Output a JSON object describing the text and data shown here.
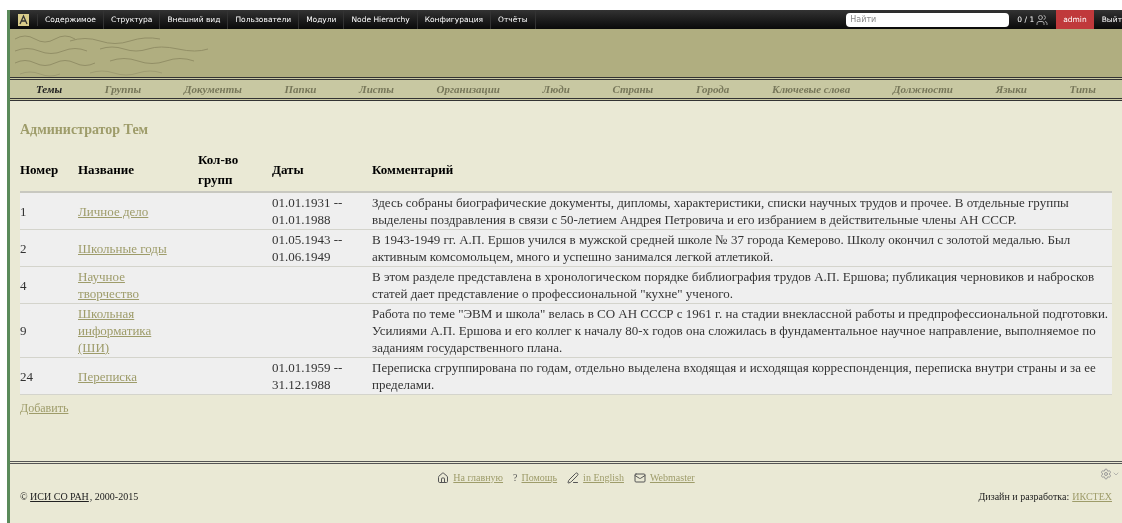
{
  "toolbar": {
    "menu": [
      "Содержимое",
      "Структура",
      "Внешний вид",
      "Пользователи",
      "Модули",
      "Node Hierarchy",
      "Конфигурация",
      "Отчёты"
    ],
    "search": {
      "placeholder": "Найти"
    },
    "users_count": "0 / 1",
    "user": "admin",
    "logout": "Выйт"
  },
  "nav": [
    {
      "label": "Темы",
      "selected": true
    },
    {
      "label": "Группы",
      "selected": false
    },
    {
      "label": "Документы",
      "selected": false
    },
    {
      "label": "Папки",
      "selected": false
    },
    {
      "label": "Листы",
      "selected": false
    },
    {
      "label": "Организации",
      "selected": false
    },
    {
      "label": "Люди",
      "selected": false
    },
    {
      "label": "Страны",
      "selected": false
    },
    {
      "label": "Города",
      "selected": false
    },
    {
      "label": "Ключевые слова",
      "selected": false
    },
    {
      "label": "Должности",
      "selected": false
    },
    {
      "label": "Языки",
      "selected": false
    },
    {
      "label": "Типы",
      "selected": false
    }
  ],
  "page_title": "Администратор Тем",
  "table": {
    "columns": [
      "Номер",
      "Название",
      "Кол-во групп",
      "Даты",
      "Комментарий"
    ],
    "rows": [
      {
        "number": "1",
        "name": "Личное дело",
        "groups": "",
        "dates": "01.01.1931 -- 01.01.1988",
        "comment": "Здесь собраны биографические документы, дипломы, характеристики, списки научных трудов и прочее. В отдельные группы выделены поздравления в связи с 50-летием Андрея Петровича и его избранием в действительные члены АН СССР."
      },
      {
        "number": "2",
        "name": "Школьные годы",
        "groups": "",
        "dates": "01.05.1943 -- 01.06.1949",
        "comment": "В 1943-1949 гг. А.П. Ершов учился в мужской средней школе № 37 города Кемерово. Школу окончил с золотой медалью. Был активным комсомольцем, много и успешно занимался легкой атлетикой."
      },
      {
        "number": "4",
        "name": "Научное творчество",
        "groups": "",
        "dates": "",
        "comment": "В этом разделе представлена в хронологическом порядке библиография трудов А.П. Ершова; публикация черновиков и набросков статей дает представление о профессиональной \"кухне\" ученого."
      },
      {
        "number": "9",
        "name": "Школьная информатика (ШИ)",
        "groups": "",
        "dates": "",
        "comment": "Работа по теме \"ЭВМ и школа\" велась в СО АН СССР с 1961 г. на стадии внеклассной работы и предпрофессиональной подготовки. Усилиями А.П. Ершова и его коллег к началу 80-х годов она сложилась в фундаментальное научное направление, выполняемое по заданиям государственного плана."
      },
      {
        "number": "24",
        "name": "Переписка",
        "groups": "",
        "dates": "01.01.1959 -- 31.12.1988",
        "comment": "Переписка сгруппирована по годам, отдельно выделена входящая и исходящая корреспонденция, переписка внутри страны и за ее пределами."
      }
    ]
  },
  "add_link": "Добавить",
  "footer": {
    "links": [
      {
        "kind": "home",
        "label": "На главную"
      },
      {
        "kind": "help",
        "icon_text": "?",
        "label": "Помощь"
      },
      {
        "kind": "lang",
        "label": "in English"
      },
      {
        "kind": "mail",
        "label": "Webmaster"
      }
    ],
    "copyright": {
      "symbol": "©",
      "link": "ИСИ СО РАН",
      "suffix": ", 2000-2015"
    },
    "credits": {
      "label": "Дизайн и разработка:",
      "link": "ИКСТЕХ"
    }
  }
}
